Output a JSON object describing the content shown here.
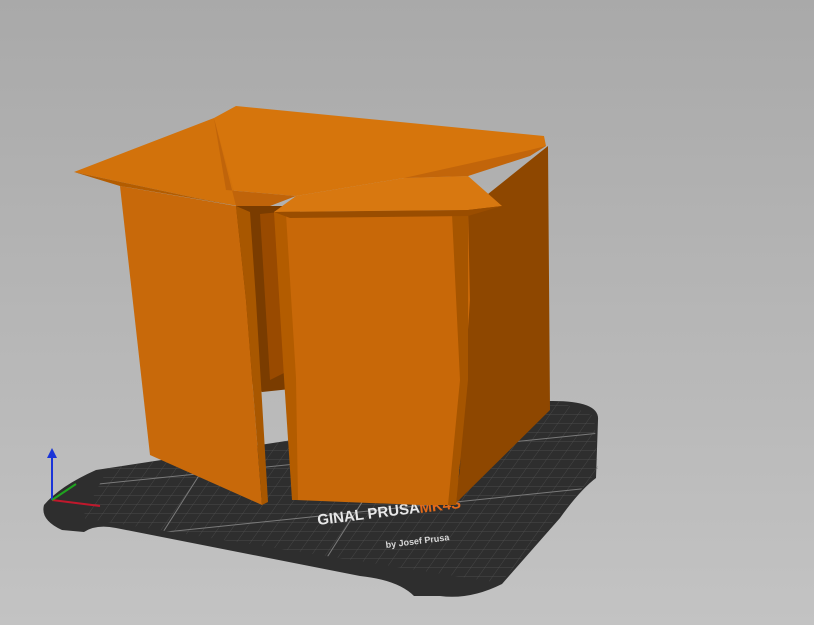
{
  "bed": {
    "brand_prefix": "GINAL PRUSA",
    "model": "MK4S",
    "subtitle": "by Josef Prusa"
  },
  "colors": {
    "background": "#b3b3b3",
    "model": "#d2700a",
    "model_shade": "#b35c00",
    "model_dark": "#8a4300",
    "bed": "#2f2f2f",
    "accent": "#e36a1a",
    "axis_x": "#c0182c",
    "axis_y": "#1fa31f",
    "axis_z": "#1a34d8"
  },
  "icons": {
    "axes": "xyz-axes-icon"
  }
}
